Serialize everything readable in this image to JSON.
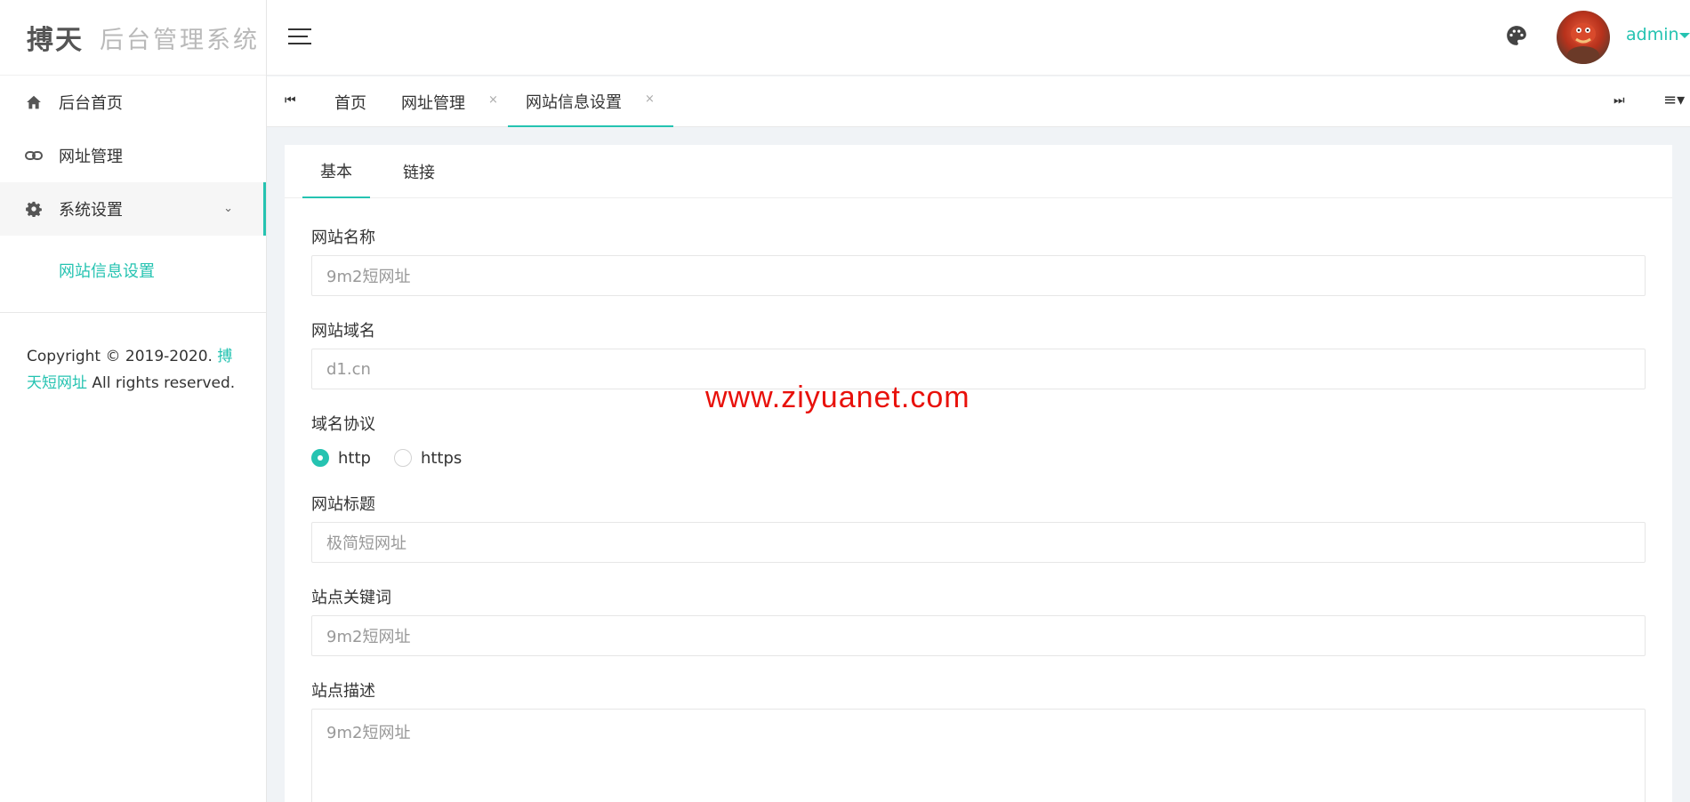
{
  "brand": {
    "name": "搏天",
    "subtitle": "后台管理系统"
  },
  "sidebar": {
    "items": [
      {
        "label": "后台首页",
        "icon": "home-icon"
      },
      {
        "label": "网址管理",
        "icon": "link-icon"
      },
      {
        "label": "系统设置",
        "icon": "gear-icon",
        "expanded": true
      }
    ],
    "submenu": [
      {
        "label": "网站信息设置"
      }
    ],
    "copyright": {
      "prefix": "Copyright © 2019-2020.",
      "link_text": "搏天短网址",
      "suffix": "All rights reserved."
    }
  },
  "header": {
    "username": "admin"
  },
  "tabs": [
    {
      "label": "首页",
      "closable": false
    },
    {
      "label": "网址管理",
      "closable": true
    },
    {
      "label": "网站信息设置",
      "closable": true,
      "active": true
    }
  ],
  "tab_close_glyph": "×",
  "subtabs": [
    {
      "label": "基本",
      "active": true
    },
    {
      "label": "链接"
    }
  ],
  "form": {
    "site_name": {
      "label": "网站名称",
      "placeholder": "9m2短网址"
    },
    "site_domain": {
      "label": "网站域名",
      "placeholder": "d1.cn"
    },
    "protocol": {
      "label": "域名协议",
      "options": [
        "http",
        "https"
      ],
      "selected": "http"
    },
    "site_title": {
      "label": "网站标题",
      "placeholder": "极简短网址"
    },
    "keywords": {
      "label": "站点关键词",
      "placeholder": "9m2短网址"
    },
    "description": {
      "label": "站点描述",
      "placeholder": "9m2短网址"
    }
  },
  "watermark": "www.ziyuanet.com",
  "colors": {
    "accent": "#25c3b1",
    "watermark": "#e8110b"
  }
}
